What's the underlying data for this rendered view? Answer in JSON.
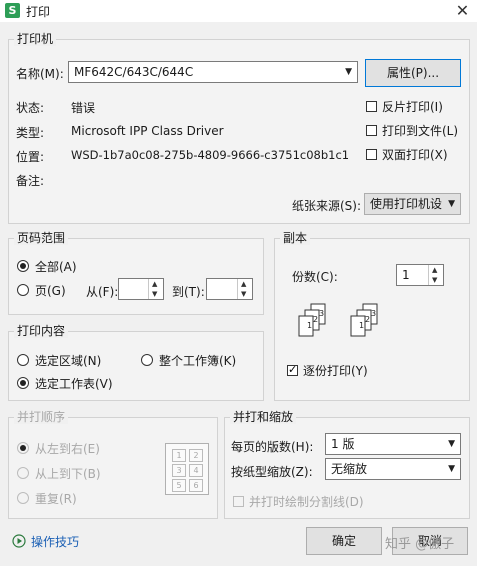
{
  "window": {
    "title": "打印",
    "app_icon": "S",
    "close": "✕"
  },
  "printer": {
    "group_title": "打印机",
    "name_label": "名称(M):",
    "name_value": "MF642C/643C/644C",
    "properties_button": "属性(P)...",
    "status_label": "状态:",
    "status_value": "错误",
    "type_label": "类型:",
    "type_value": "Microsoft IPP Class Driver",
    "location_label": "位置:",
    "location_value": "WSD-1b7a0c08-275b-4809-9666-c3751c08b1c1",
    "comment_label": "备注:",
    "reverse_label": "反片打印(I)",
    "to_file_label": "打印到文件(L)",
    "duplex_label": "双面打印(X)",
    "paper_source_label": "纸张来源(S):",
    "paper_source_value": "使用打印机设"
  },
  "page_range": {
    "group_title": "页码范围",
    "all_label": "全部(A)",
    "pages_label": "页(G)",
    "from_label": "从(F):",
    "to_label": "到(T):"
  },
  "copies": {
    "group_title": "副本",
    "count_label": "份数(C):",
    "count_value": "1",
    "collate_label": "逐份打印(Y)"
  },
  "content": {
    "group_title": "打印内容",
    "selection_label": "选定区域(N)",
    "workbook_label": "整个工作簿(K)",
    "sheet_label": "选定工作表(V)"
  },
  "order": {
    "group_title": "并打顺序",
    "ltr_label": "从左到右(E)",
    "ttb_label": "从上到下(B)",
    "repeat_label": "重复(R)",
    "grid": [
      "1",
      "2",
      "3",
      "4",
      "5",
      "6"
    ]
  },
  "scale": {
    "group_title": "并打和缩放",
    "pages_per_sheet_label": "每页的版数(H):",
    "pages_per_sheet_value": "1 版",
    "scale_label": "按纸型缩放(Z):",
    "scale_value": "无缩放",
    "draw_lines_label": "并打时绘制分割线(D)"
  },
  "footer": {
    "tips_label": "操作技巧",
    "ok_button": "确定",
    "cancel_button": "取消",
    "watermark": "知乎 @傲子"
  }
}
